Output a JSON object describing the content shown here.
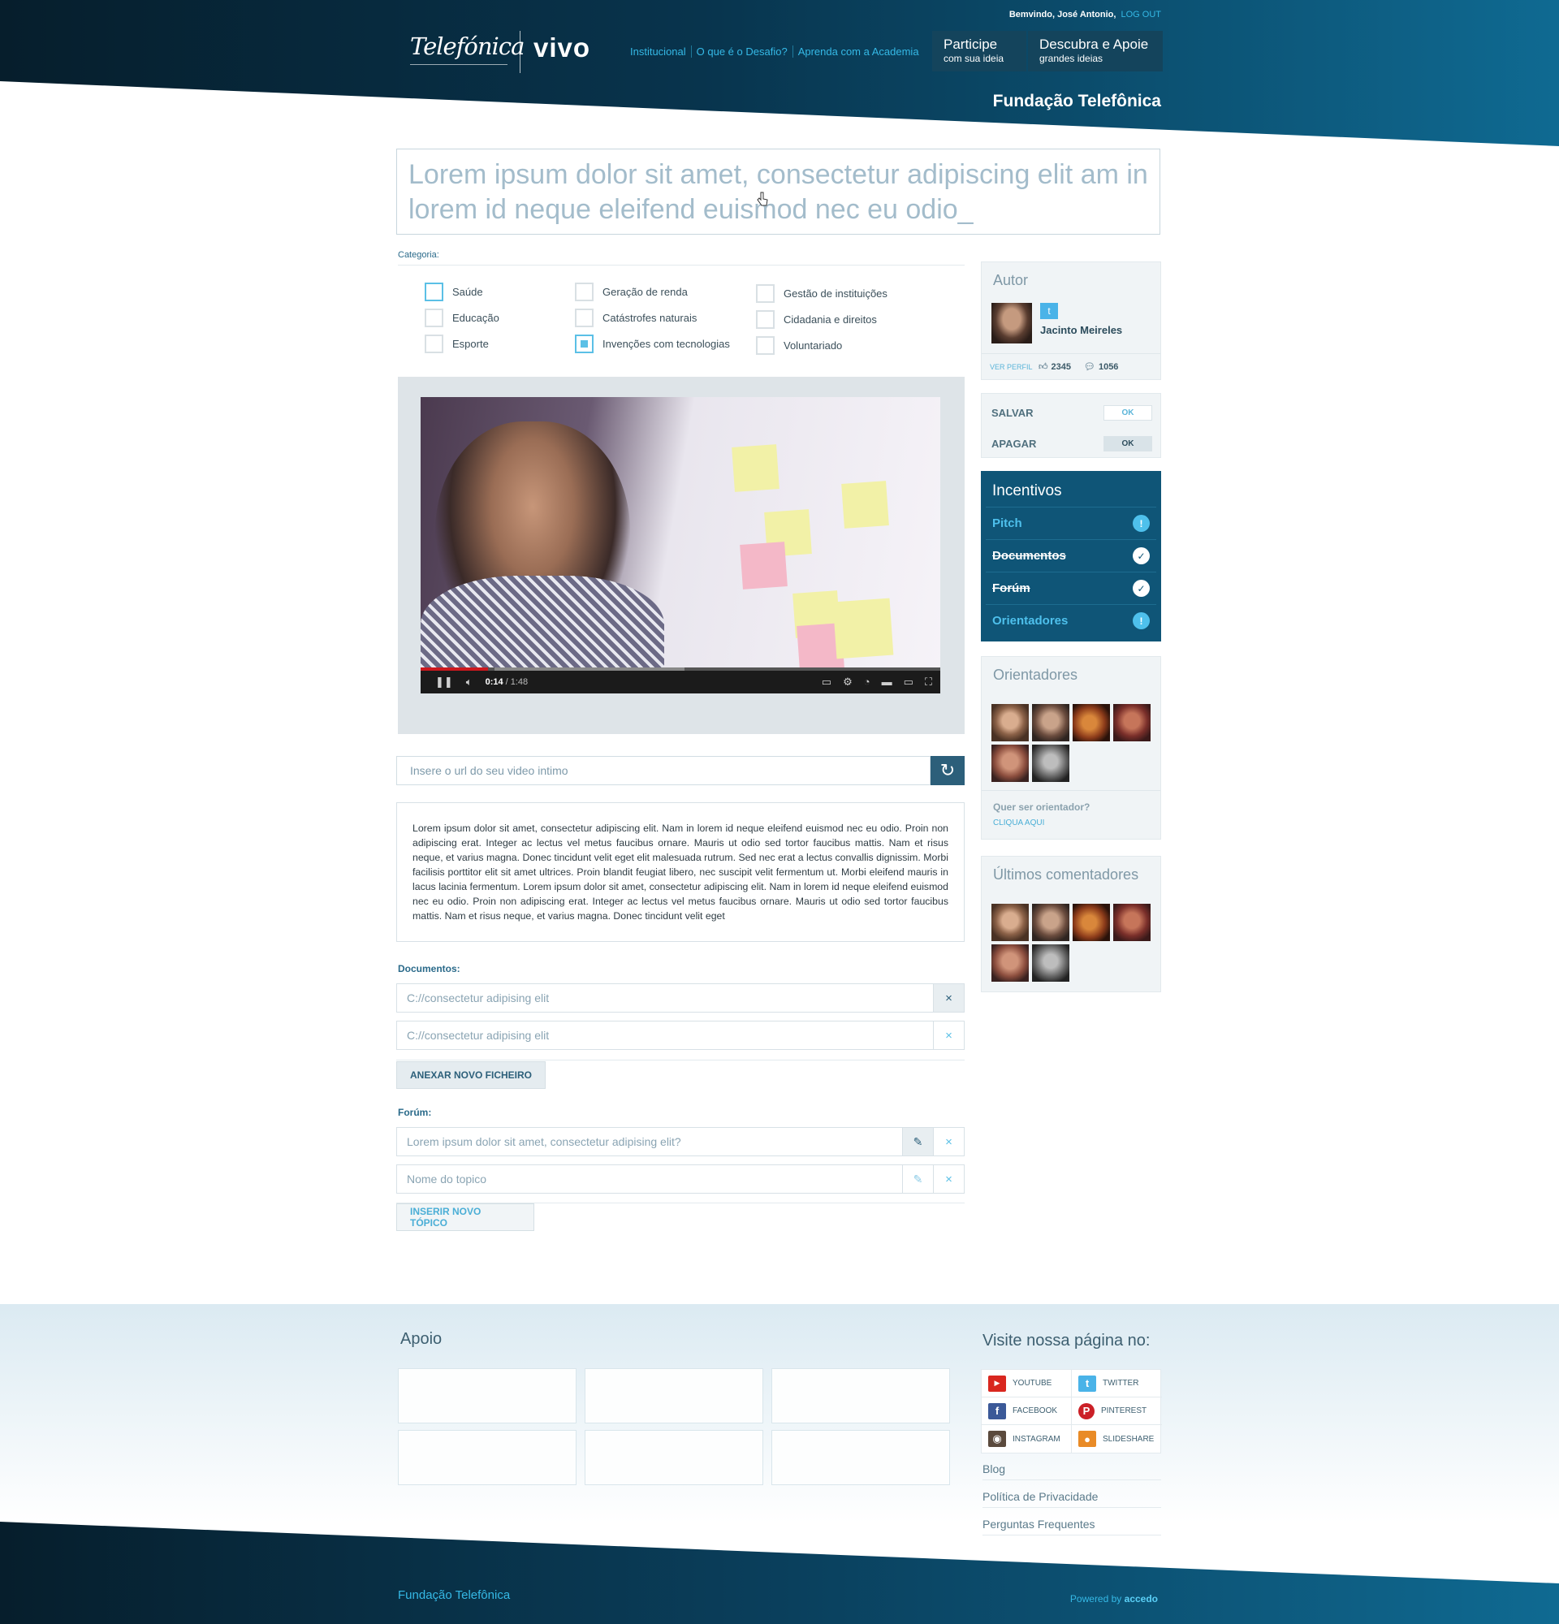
{
  "header": {
    "welcome_text": "Bemvindo, José Antonio,",
    "logout_label": "LOG OUT",
    "logo_telefonica": "Telefónica",
    "logo_vivo": "vivo",
    "nav": [
      "Institucional",
      "O que é o Desafio?",
      "Aprenda com a Academia"
    ],
    "participe_line1": "Participe",
    "participe_line2": "com sua ideia",
    "descubra_line1": "Descubra e Apoie",
    "descubra_line2": "grandes ideias",
    "foundation": "Fundação Telefônica"
  },
  "title_input": {
    "value": "Lorem ipsum dolor sit amet, consectetur adipiscing elit am in lorem id neque eleifend euismod nec eu odio_"
  },
  "categories": {
    "label": "Categoria:",
    "col1": [
      {
        "label": "Saúde",
        "state": "hover"
      },
      {
        "label": "Educação",
        "state": "unchecked"
      },
      {
        "label": "Esporte",
        "state": "unchecked"
      }
    ],
    "col2": [
      {
        "label": "Geração de renda",
        "state": "unchecked"
      },
      {
        "label": "Catástrofes naturais",
        "state": "unchecked"
      },
      {
        "label": "Invenções com tecnologias",
        "state": "checked"
      }
    ],
    "col3": [
      {
        "label": "Gestão de instituições",
        "state": "unchecked"
      },
      {
        "label": "Cidadania e direitos",
        "state": "unchecked"
      },
      {
        "label": "Voluntariado",
        "state": "unchecked"
      }
    ]
  },
  "video": {
    "time_current": "0:14",
    "time_total": "/ 1:48",
    "progress": 0.13
  },
  "url_input": {
    "placeholder": "Insere o url do seu video intimo"
  },
  "description": {
    "text": "Lorem ipsum dolor sit amet, consectetur adipiscing elit. Nam in lorem id neque eleifend euismod nec eu odio. Proin non adipiscing erat. Integer ac lectus vel metus faucibus ornare. Mauris ut odio sed tortor faucibus mattis. Nam et risus neque, et varius magna. Donec tincidunt velit eget elit malesuada rutrum. Sed nec erat a lectus convallis dignissim. Morbi facilisis porttitor elit sit amet ultrices. Proin blandit feugiat libero, nec suscipit velit fermentum ut. Morbi eleifend mauris in lacus lacinia fermentum. Lorem ipsum dolor sit amet, consectetur adipiscing elit. Nam in lorem id neque eleifend euismod nec eu odio. Proin non adipiscing erat. Integer ac lectus vel metus faucibus ornare. Mauris ut odio sed tortor faucibus mattis. Nam et risus neque, et varius magna. Donec tincidunt velit eget"
  },
  "documents": {
    "label": "Documentos:",
    "files": [
      "C://consectetur adipising elit",
      "C://consectetur adipising elit"
    ],
    "remove_icon": "×",
    "attach_label": "ANEXAR NOVO FICHEIRO"
  },
  "forum": {
    "label": "Forúm:",
    "topics": [
      "Lorem ipsum dolor sit amet, consectetur adipising elit?",
      "Nome do topico"
    ],
    "edit_icon": "✎",
    "remove_icon": "×",
    "insert_label": "INSERIR NOVO TÓPICO"
  },
  "sidebar": {
    "author": {
      "title": "Autor",
      "name": "Jacinto Meireles",
      "twitter_icon": "t",
      "view_profile": "VER PERFIL",
      "likes": "2345",
      "comments": "1056"
    },
    "actions": {
      "save_label": "SALVAR",
      "delete_label": "APAGAR",
      "ok_label": "OK"
    },
    "incentives": {
      "title": "Incentivos",
      "items": [
        {
          "label": "Pitch",
          "done": false,
          "badge": "!"
        },
        {
          "label": "Documentos",
          "done": true,
          "badge": "✓"
        },
        {
          "label": "Forúm",
          "done": true,
          "badge": "✓"
        },
        {
          "label": "Orientadores",
          "done": false,
          "badge": "!"
        }
      ]
    },
    "mentors": {
      "title": "Orientadores",
      "question": "Quer ser orientador?",
      "cta": "CLIQUA AQUI"
    },
    "commenters": {
      "title": "Últimos comentadores"
    }
  },
  "footer": {
    "support_title": "Apoio",
    "visit_title": "Visite nossa página no:",
    "social": [
      {
        "label": "YOUTUBE",
        "icon": "youtube-icon",
        "color": "#d9271f"
      },
      {
        "label": "TWITTER",
        "icon": "twitter-icon",
        "color": "#4ab3e8"
      },
      {
        "label": "FACEBOOK",
        "icon": "facebook-icon",
        "color": "#3b5998"
      },
      {
        "label": "PINTEREST",
        "icon": "pinterest-icon",
        "color": "#cb2027"
      },
      {
        "label": "INSTAGRAM",
        "icon": "instagram-icon",
        "color": "#5b4a3d"
      },
      {
        "label": "SLIDESHARE",
        "icon": "slideshare-icon",
        "color": "#e98b27"
      }
    ],
    "links": [
      "Blog",
      "Política de Privacidade",
      "Perguntas Frequentes"
    ],
    "brand": "Fundação Telefônica",
    "powered_prefix": "Powered by",
    "powered_brand": "accedo"
  },
  "colors": {
    "header_dark": "#061e2c",
    "header_blue": "#0f6a92",
    "accent": "#35b9e6",
    "incentive_bg": "#0f5577"
  }
}
